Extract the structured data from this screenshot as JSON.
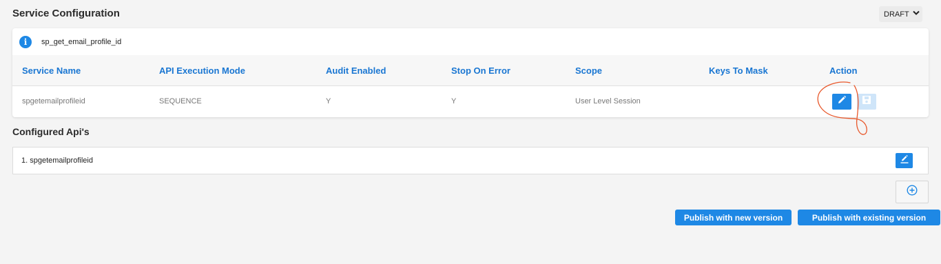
{
  "header": {
    "title": "Service Configuration",
    "status": "DRAFT"
  },
  "info": {
    "service_id": "sp_get_email_profile_id"
  },
  "table": {
    "columns": [
      "Service Name",
      "API Execution Mode",
      "Audit Enabled",
      "Stop On Error",
      "Scope",
      "Keys To Mask",
      "Action"
    ],
    "row": {
      "service_name": "spgetemailprofileid",
      "execution_mode": "SEQUENCE",
      "audit_enabled": "Y",
      "stop_on_error": "Y",
      "scope": "User Level Session",
      "keys_to_mask": ""
    }
  },
  "configured_apis": {
    "title": "Configured Api's",
    "items": [
      "1. spgetemailprofileid"
    ]
  },
  "actions": {
    "publish_new": "Publish with new version",
    "publish_existing": "Publish with existing version"
  },
  "icons": {
    "info": "info-icon",
    "edit": "pencil-icon",
    "save": "save-icon",
    "api_edit": "edit-icon",
    "add": "plus-circle-icon",
    "dropdown": "chevron-down-icon"
  },
  "colors": {
    "primary": "#1e88e5",
    "header_text": "#1976d2",
    "annotation": "#e8572a"
  }
}
